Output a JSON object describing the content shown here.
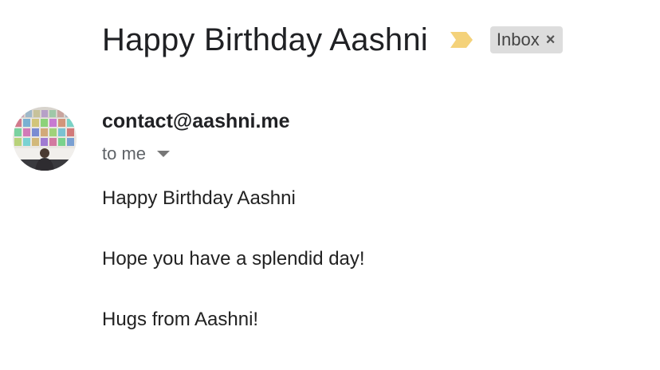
{
  "email": {
    "subject": "Happy Birthday Aashni",
    "importance_icon": "importance-marker-icon",
    "importance_color": "#f4d27a",
    "label": {
      "text": "Inbox",
      "close_glyph": "×"
    },
    "sender": {
      "address": "contact@aashni.me",
      "avatar_icon": "sender-avatar"
    },
    "recipient": {
      "text": "to me",
      "dropdown_icon": "caret-down-icon"
    },
    "body": [
      "Happy Birthday Aashni",
      "Hope you have a splendid day!",
      "Hugs from Aashni!"
    ]
  }
}
